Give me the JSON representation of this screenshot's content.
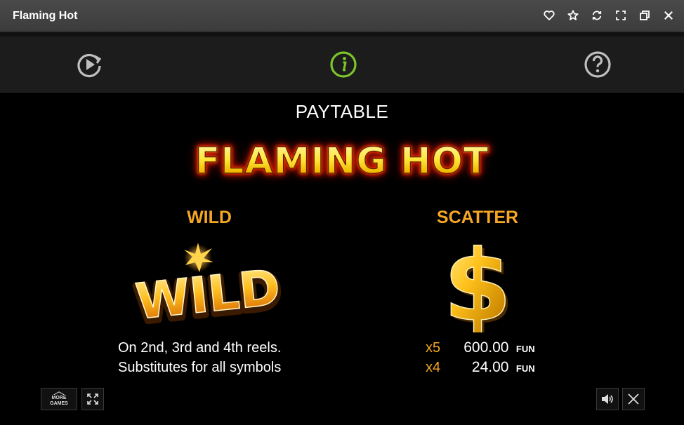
{
  "window": {
    "title": "Flaming Hot",
    "controls": [
      "heart-icon",
      "star-icon",
      "refresh-icon",
      "expand-icon",
      "restore-icon",
      "close-icon"
    ]
  },
  "toolbar": {
    "items": [
      {
        "name": "autoplay-icon",
        "color": "#bfbfbf"
      },
      {
        "name": "info-icon",
        "color": "#7dc52b",
        "active": true
      },
      {
        "name": "help-icon",
        "color": "#bfbfbf"
      }
    ]
  },
  "paytable": {
    "heading": "PAYTABLE",
    "logo_text": "FLAMING HOT",
    "wild": {
      "title": "WILD",
      "symbol_text": "WILD",
      "line1": "On 2nd, 3rd and 4th reels.",
      "line2": "Substitutes for all symbols"
    },
    "scatter": {
      "title": "SCATTER",
      "symbol": "$",
      "payouts": [
        {
          "mult": "x5",
          "amount": "600.00",
          "currency": "FUN"
        },
        {
          "mult": "x4",
          "amount": "24.00",
          "currency": "FUN"
        }
      ]
    }
  },
  "bottom": {
    "more_games_line1": "MORE",
    "more_games_line2": "GAMES"
  },
  "colors": {
    "accent_orange": "#f5a623",
    "active_green": "#7dc52b"
  }
}
